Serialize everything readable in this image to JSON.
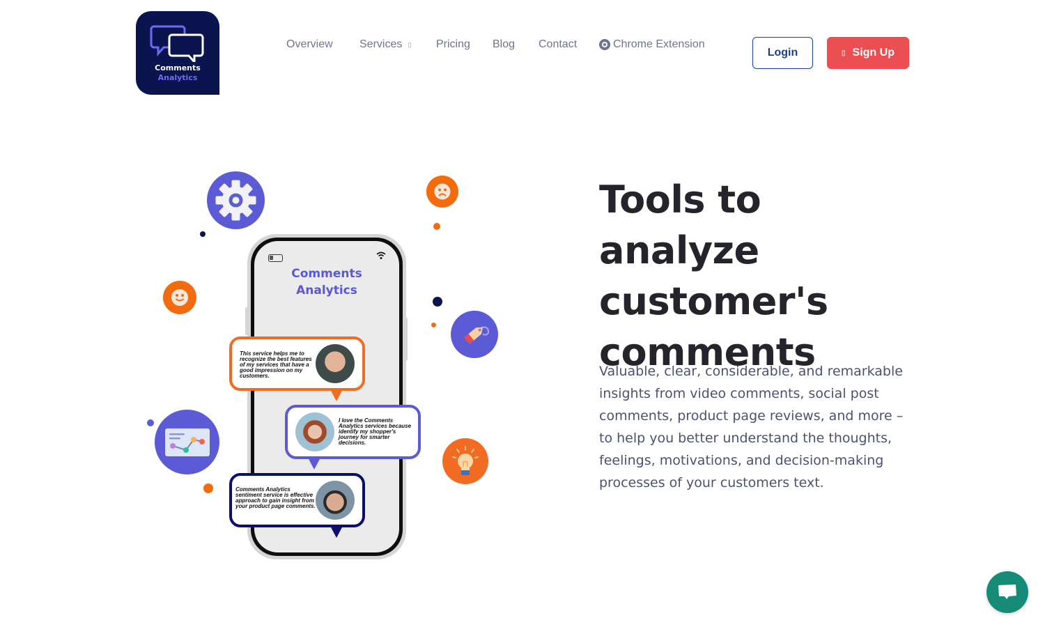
{
  "brand": {
    "name_line1": "Comments",
    "name_line2": "Analytics",
    "logo_bg": "#0a1550",
    "accent": "#6d6cf0"
  },
  "nav": {
    "items": [
      {
        "label": "Overview"
      },
      {
        "label": "Services",
        "has_dropdown": true,
        "chevron": "▯"
      },
      {
        "label": "Pricing"
      },
      {
        "label": "Blog"
      },
      {
        "label": "Contact"
      },
      {
        "label": "Chrome Extension",
        "icon": "chrome-icon"
      }
    ]
  },
  "auth": {
    "login_label": "Login",
    "signup_label": "Sign Up",
    "signup_icon": "▯",
    "signup_color": "#ec4f51",
    "login_color": "#1b3f8f"
  },
  "hero": {
    "title": "Tools to analyze customer's comments",
    "description": "Valuable, clear, considerable, and remarkable insights from video comments, social post comments, product page reviews, and more – to help you better understand the thoughts, feelings, motivations, and decision-making processes of your customers text."
  },
  "illustration": {
    "phone_title_line1": "Comments",
    "phone_title_line2": "Analytics",
    "testimonials": [
      {
        "text": "This service helps me to recognize the best features of my services that have a good impression on my customers.",
        "border_color": "#f26b22"
      },
      {
        "text": "I love the Comments Analytics services because identify my shopper's journey for smarter decisions.",
        "border_color": "#5b5bd6"
      },
      {
        "text": "Comments Analytics sentiment service is effective approach to gain insight from your product page comments.",
        "border_color": "#0a0f6b"
      }
    ],
    "icons": [
      "gear-icon",
      "sad-face-icon",
      "smile-face-icon",
      "price-tag-icon",
      "chart-card-icon",
      "lightbulb-icon"
    ]
  },
  "chat_widget": {
    "icon": "chat-bubble-icon",
    "color": "#168c78"
  }
}
